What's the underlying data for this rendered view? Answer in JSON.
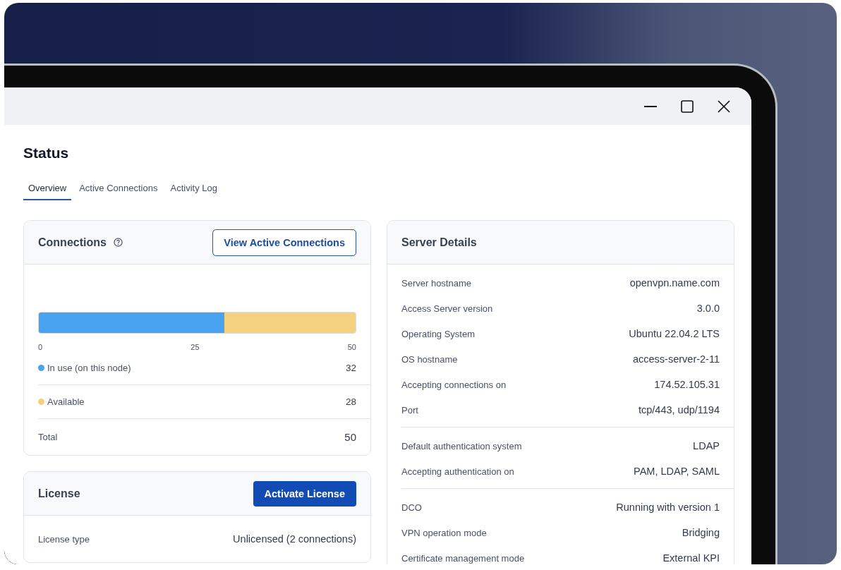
{
  "page": {
    "title": "Status"
  },
  "tabs": [
    {
      "label": "Overview",
      "selected": true
    },
    {
      "label": "Active Connections",
      "selected": false
    },
    {
      "label": "Activity Log",
      "selected": false
    }
  ],
  "connections": {
    "title": "Connections",
    "action": "View Active Connections",
    "usage": {
      "level": 0.586
    },
    "ticks": [
      "0",
      "25",
      "50"
    ],
    "rows": [
      {
        "kind": "legend",
        "label": "In use (on this node)",
        "value": "32",
        "color": "#4aa3f0"
      },
      {
        "kind": "legend",
        "label": "Available",
        "value": "28",
        "color": "#f3d17f"
      },
      {
        "kind": "total",
        "label": "Total",
        "value": "50"
      }
    ]
  },
  "license": {
    "title": "License",
    "action": "Activate License",
    "rows": [
      {
        "label": "License type",
        "value": "Unlicensed (2 connections)"
      }
    ]
  },
  "server_details": {
    "title": "Server Details",
    "groups": [
      {
        "rows": [
          {
            "label": "Server hostname",
            "value": "openvpn.name.com"
          },
          {
            "label": "Access Server version",
            "value": "3.0.0"
          },
          {
            "label": "Operating System",
            "value": "Ubuntu 22.04.2 LTS"
          },
          {
            "label": "OS hostname",
            "value": "access-server-2-11"
          },
          {
            "label": "Accepting connections on",
            "value": "174.52.105.31"
          },
          {
            "label": "Port",
            "value": "tcp/443, udp/1194"
          }
        ]
      },
      {
        "rows": [
          {
            "label": "Default authentication system",
            "value": "LDAP"
          },
          {
            "label": "Accepting authentication on",
            "value": "PAM, LDAP, SAML"
          }
        ]
      },
      {
        "rows": [
          {
            "label": "DCO",
            "value": "Running with version 1"
          },
          {
            "label": "VPN operation mode",
            "value": "Bridging"
          },
          {
            "label": "Certificate management mode",
            "value": "External KPI"
          }
        ]
      }
    ]
  }
}
